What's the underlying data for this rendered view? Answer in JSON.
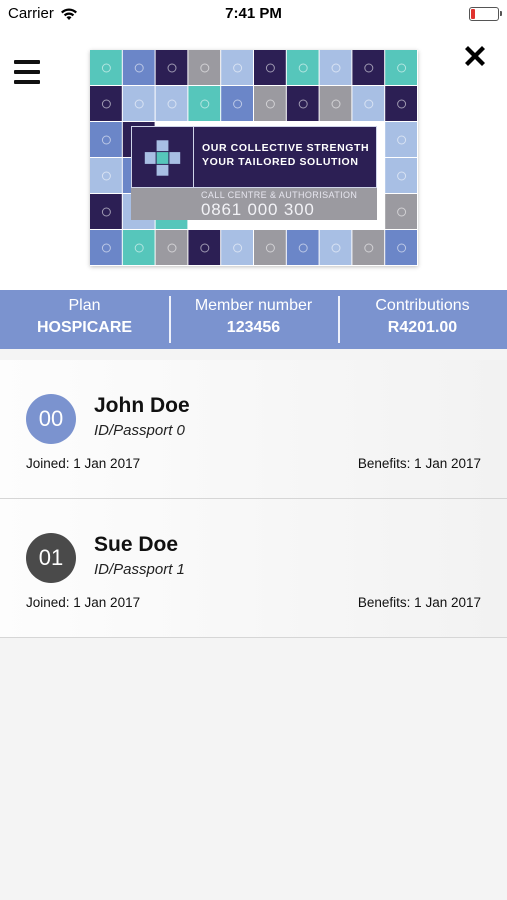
{
  "status_bar": {
    "carrier": "Carrier",
    "time": "7:41 PM",
    "battery_color": "#e0332f"
  },
  "header": {
    "menu_icon": "hamburger-icon",
    "close_icon": "close-x-icon",
    "card": {
      "tagline_line1": "OUR COLLECTIVE STRENGTH",
      "tagline_line2": "YOUR TAILORED SOLUTION",
      "call_label": "CALL CENTRE & AUTHORISATION",
      "call_number": "0861 000 300"
    }
  },
  "summary": [
    {
      "label": "Plan",
      "value": "HOSPICARE"
    },
    {
      "label": "Member number",
      "value": "123456"
    },
    {
      "label": "Contributions",
      "value": "R4201.00"
    }
  ],
  "members": [
    {
      "code": "00",
      "name": "John Doe",
      "id": "ID/Passport 0",
      "joined": "Joined: 1 Jan 2017",
      "benefits": "Benefits: 1 Jan 2017",
      "avatar_color": "#7b93cf"
    },
    {
      "code": "01",
      "name": "Sue Doe",
      "id": "ID/Passport 1",
      "joined": "Joined: 1 Jan 2017",
      "benefits": "Benefits: 1 Jan 2017",
      "avatar_color": "#4a4a4a"
    }
  ],
  "colors": {
    "accent": "#7b93cf",
    "card_navy": "#2c1f54",
    "card_teal": "#56c6bb",
    "card_blue": "#6b86c8",
    "card_light": "#a8bfe4",
    "card_gray": "#9b9aa0"
  }
}
